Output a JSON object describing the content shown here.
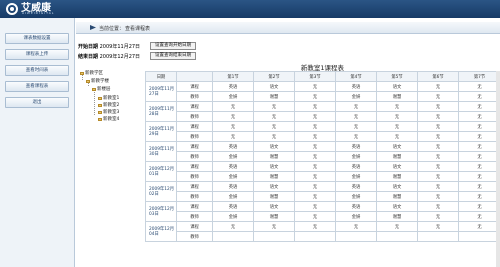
{
  "header": {
    "logo_text": "艾威康",
    "logo_sub": "AIWEIDIGITAL"
  },
  "sidebar": {
    "items": [
      {
        "label": "课表数据设置"
      },
      {
        "label": "课程表上传"
      },
      {
        "label": "查看时间表"
      },
      {
        "label": "查看课程表"
      },
      {
        "label": "退出"
      }
    ]
  },
  "breadcrumb": {
    "label": "当前位置：",
    "value": "查看课程表"
  },
  "dates": {
    "start_label": "开始日期",
    "start_value": "2009年11月27日",
    "end_label": "结束日期",
    "end_value": "2009年12月27日",
    "set_start_button": "设置查询开始日期",
    "set_end_button": "设置查询结束日期"
  },
  "tree": {
    "root": "新教学区",
    "building": "新教学楼",
    "floor": "新楼层",
    "rooms": [
      "新教室1",
      "新教室2",
      "新教室3",
      "新教室4"
    ]
  },
  "schedule": {
    "title": "新教室1课程表",
    "headers": [
      "日期",
      "",
      "第1节",
      "第2节",
      "第3节",
      "第4节",
      "第5节",
      "第6节",
      "第7节"
    ],
    "days": [
      {
        "date": "2009年11月27日",
        "course": [
          "英语",
          "语文",
          "无",
          "英语",
          "语文",
          "无",
          "无"
        ],
        "teacher": [
          "金妍",
          "谢慧",
          "无",
          "金妍",
          "谢慧",
          "无",
          "无"
        ]
      },
      {
        "date": "2009年11月28日",
        "course": [
          "无",
          "无",
          "无",
          "无",
          "无",
          "无",
          "无"
        ],
        "teacher": [
          "无",
          "无",
          "无",
          "无",
          "无",
          "无",
          "无"
        ]
      },
      {
        "date": "2009年11月29日",
        "course": [
          "无",
          "无",
          "无",
          "无",
          "无",
          "无",
          "无"
        ],
        "teacher": [
          "无",
          "无",
          "无",
          "无",
          "无",
          "无",
          "无"
        ]
      },
      {
        "date": "2009年11月30日",
        "course": [
          "英语",
          "语文",
          "无",
          "英语",
          "语文",
          "无",
          "无"
        ],
        "teacher": [
          "金妍",
          "谢慧",
          "无",
          "金妍",
          "谢慧",
          "无",
          "无"
        ]
      },
      {
        "date": "2009年12月01日",
        "course": [
          "英语",
          "语文",
          "无",
          "英语",
          "语文",
          "无",
          "无"
        ],
        "teacher": [
          "金妍",
          "谢慧",
          "无",
          "金妍",
          "谢慧",
          "无",
          "无"
        ]
      },
      {
        "date": "2009年12月02日",
        "course": [
          "英语",
          "语文",
          "无",
          "英语",
          "语文",
          "无",
          "无"
        ],
        "teacher": [
          "金妍",
          "谢慧",
          "无",
          "金妍",
          "谢慧",
          "无",
          "无"
        ]
      },
      {
        "date": "2009年12月03日",
        "course": [
          "英语",
          "语文",
          "无",
          "英语",
          "语文",
          "无",
          "无"
        ],
        "teacher": [
          "金妍",
          "谢慧",
          "无",
          "金妍",
          "谢慧",
          "无",
          "无"
        ]
      },
      {
        "date": "2009年12月04日",
        "course": [
          "无",
          "无",
          "无",
          "无",
          "无",
          "无",
          "无"
        ],
        "teacher": []
      }
    ],
    "row_labels": {
      "course": "课程",
      "teacher": "教师"
    }
  },
  "colors": {
    "header_bg": "#163a66",
    "grid_border": "#c8d3de"
  }
}
